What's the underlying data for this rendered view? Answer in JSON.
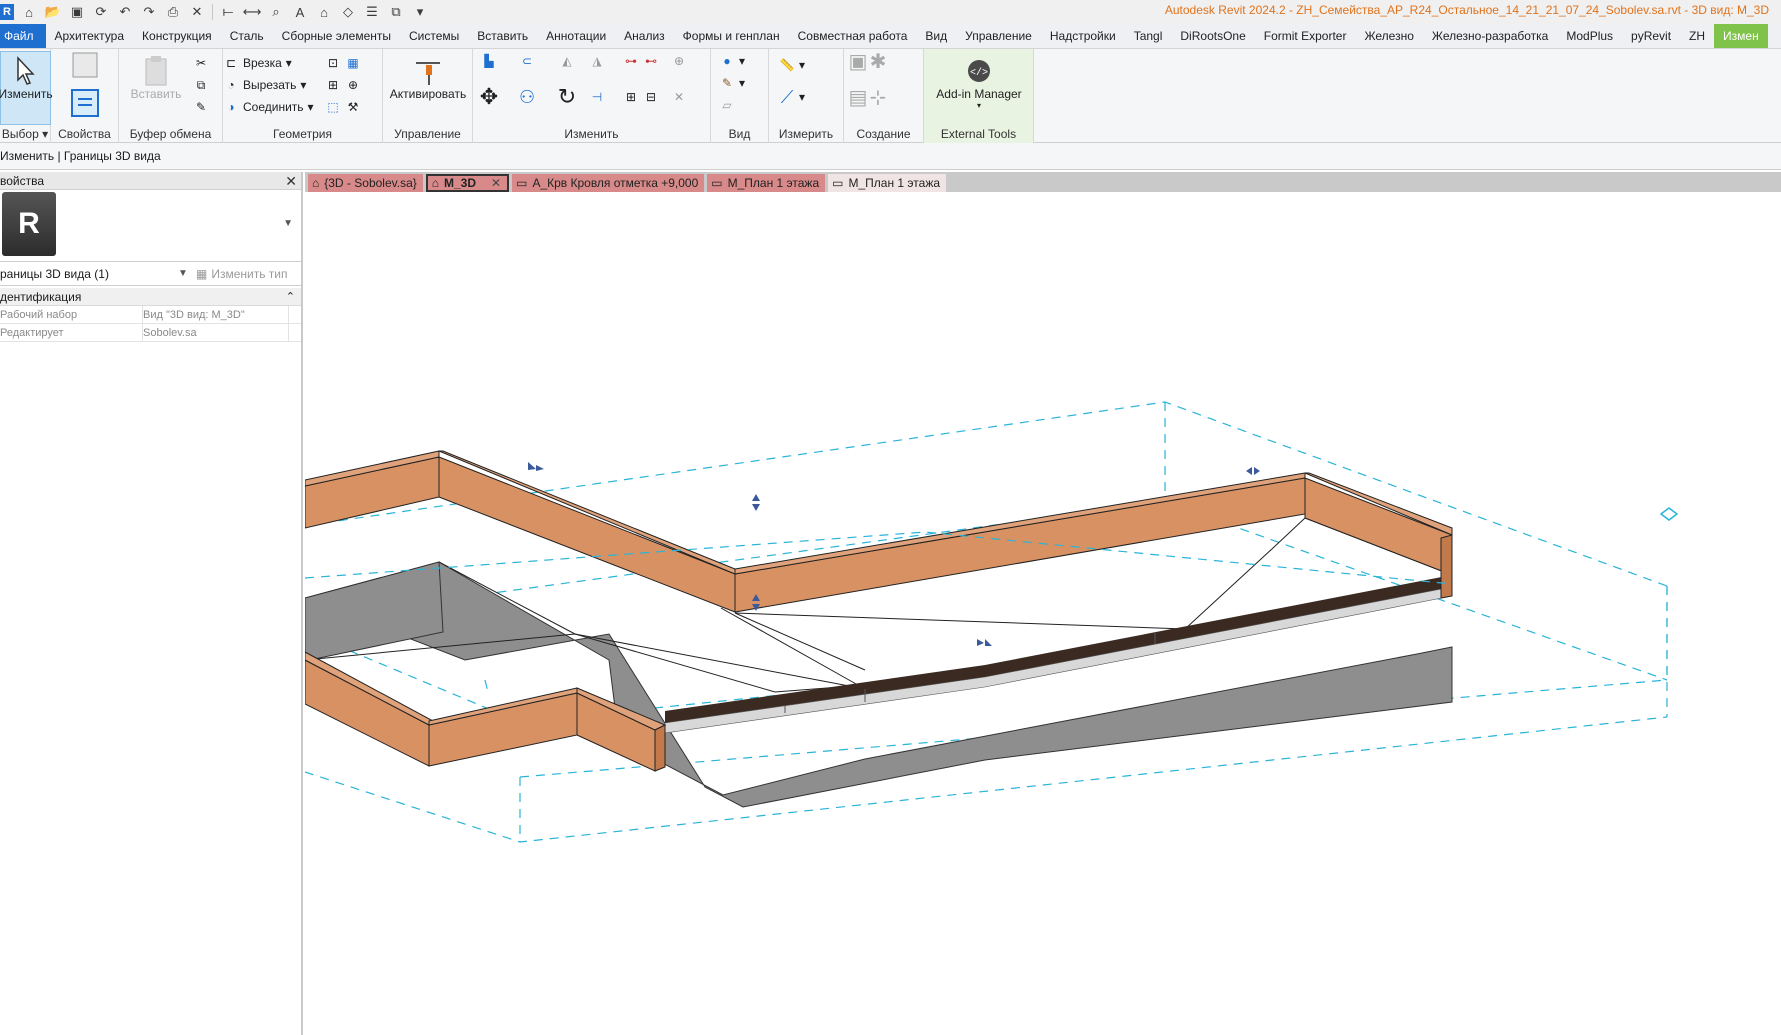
{
  "window": {
    "title": "Autodesk Revit 2024.2 - ZH_Семейства_АР_R24_Остальное_14_21_21_07_24_Sobolev.sa.rvt - 3D вид: M_3D",
    "app_icon": "R"
  },
  "ribbon": {
    "tabs": [
      "Файл",
      "Архитектура",
      "Конструкция",
      "Сталь",
      "Сборные элементы",
      "Системы",
      "Вставить",
      "Аннотации",
      "Анализ",
      "Формы и генплан",
      "Совместная работа",
      "Вид",
      "Управление",
      "Надстройки",
      "Tangl",
      "DiRootsOne",
      "Formit Exporter",
      "Железно",
      "Железно-разработка",
      "ModPlus",
      "pyRevit",
      "ZH",
      "Измен"
    ],
    "active_tab": "Измен",
    "select_panel": {
      "modify_label": "Изменить",
      "label": "Выбор"
    },
    "properties_panel": {
      "label": "Свойства",
      "button_label": "Свойства"
    },
    "clipboard_panel": {
      "paste_label": "Вставить",
      "label": "Буфер обмена"
    },
    "geometry_panel": {
      "cope_label": "Врезка",
      "cut_label": "Вырезать",
      "join_label": "Соединить",
      "label": "Геометрия"
    },
    "control_panel": {
      "activate_label": "Активировать",
      "label": "Управление"
    },
    "modify_panel": {
      "label": "Изменить"
    },
    "view_panel": {
      "label": "Вид"
    },
    "measure_panel": {
      "label": "Измерить"
    },
    "create_panel": {
      "label": "Создание"
    },
    "external_tools_panel": {
      "addin_label": "Add-in Manager",
      "label": "External Tools"
    }
  },
  "options_bar": {
    "text": "Изменить | Границы 3D вида"
  },
  "properties": {
    "header": "войства",
    "type_icon": "R",
    "instance_selector": "раницы 3D вида (1)",
    "edit_type_label": "Изменить тип",
    "category": "дентификация",
    "rows": [
      {
        "name": "Рабочий набор",
        "value": "Вид \"3D вид: M_3D\""
      },
      {
        "name": "Редактирует",
        "value": "Sobolev.sa"
      }
    ]
  },
  "view_tabs": [
    {
      "label": "{3D - Sobolev.sa}",
      "state": "red"
    },
    {
      "label": "M_3D",
      "state": "active"
    },
    {
      "label": "А_Крв Кровля отметка +9,000",
      "state": "red"
    },
    {
      "label": "М_План 1 этажа",
      "state": "red"
    },
    {
      "label": "М_План 1 этажа",
      "state": "light"
    }
  ],
  "colors": {
    "parapet": "#d89163",
    "roof_surface": "#8e8e8e",
    "section_box": "#29b4d8",
    "ribbon_active": "#80c34a",
    "file_tab": "#1f6fd1",
    "title": "#e0731d"
  }
}
